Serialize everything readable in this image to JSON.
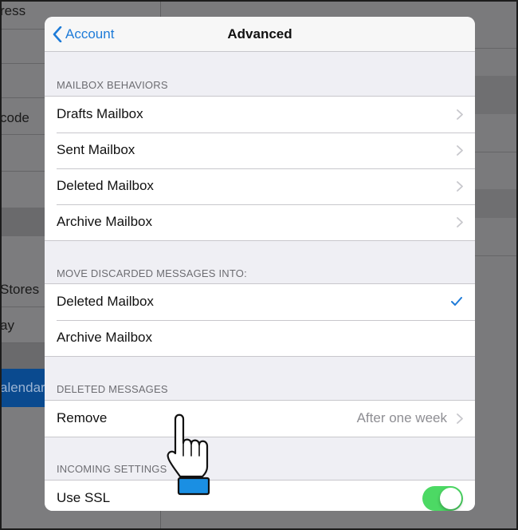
{
  "background": {
    "rows": [
      "ress",
      "code",
      "Stores",
      "ay",
      "alendar"
    ]
  },
  "nav": {
    "back_label": "Account",
    "title": "Advanced"
  },
  "sections": {
    "mailbox_behaviors": {
      "header": "MAILBOX BEHAVIORS",
      "items": [
        {
          "label": "Drafts Mailbox"
        },
        {
          "label": "Sent Mailbox"
        },
        {
          "label": "Deleted Mailbox"
        },
        {
          "label": "Archive Mailbox"
        }
      ]
    },
    "move_discarded": {
      "header": "MOVE DISCARDED MESSAGES INTO:",
      "items": [
        {
          "label": "Deleted Mailbox",
          "selected": true
        },
        {
          "label": "Archive Mailbox",
          "selected": false
        }
      ]
    },
    "deleted_messages": {
      "header": "DELETED MESSAGES",
      "remove_label": "Remove",
      "remove_value": "After one week"
    },
    "incoming_settings": {
      "header": "INCOMING SETTINGS",
      "ssl_label": "Use SSL",
      "ssl_enabled": true
    }
  },
  "colors": {
    "accent": "#1e7bd8",
    "toggle_on": "#4cd964",
    "pointer_cuff": "#1a8fe3"
  },
  "icons": {
    "back": "chevron-left-icon",
    "disclosure": "chevron-right-icon",
    "selected": "checkmark-icon",
    "pointer": "pointing-hand-icon"
  }
}
